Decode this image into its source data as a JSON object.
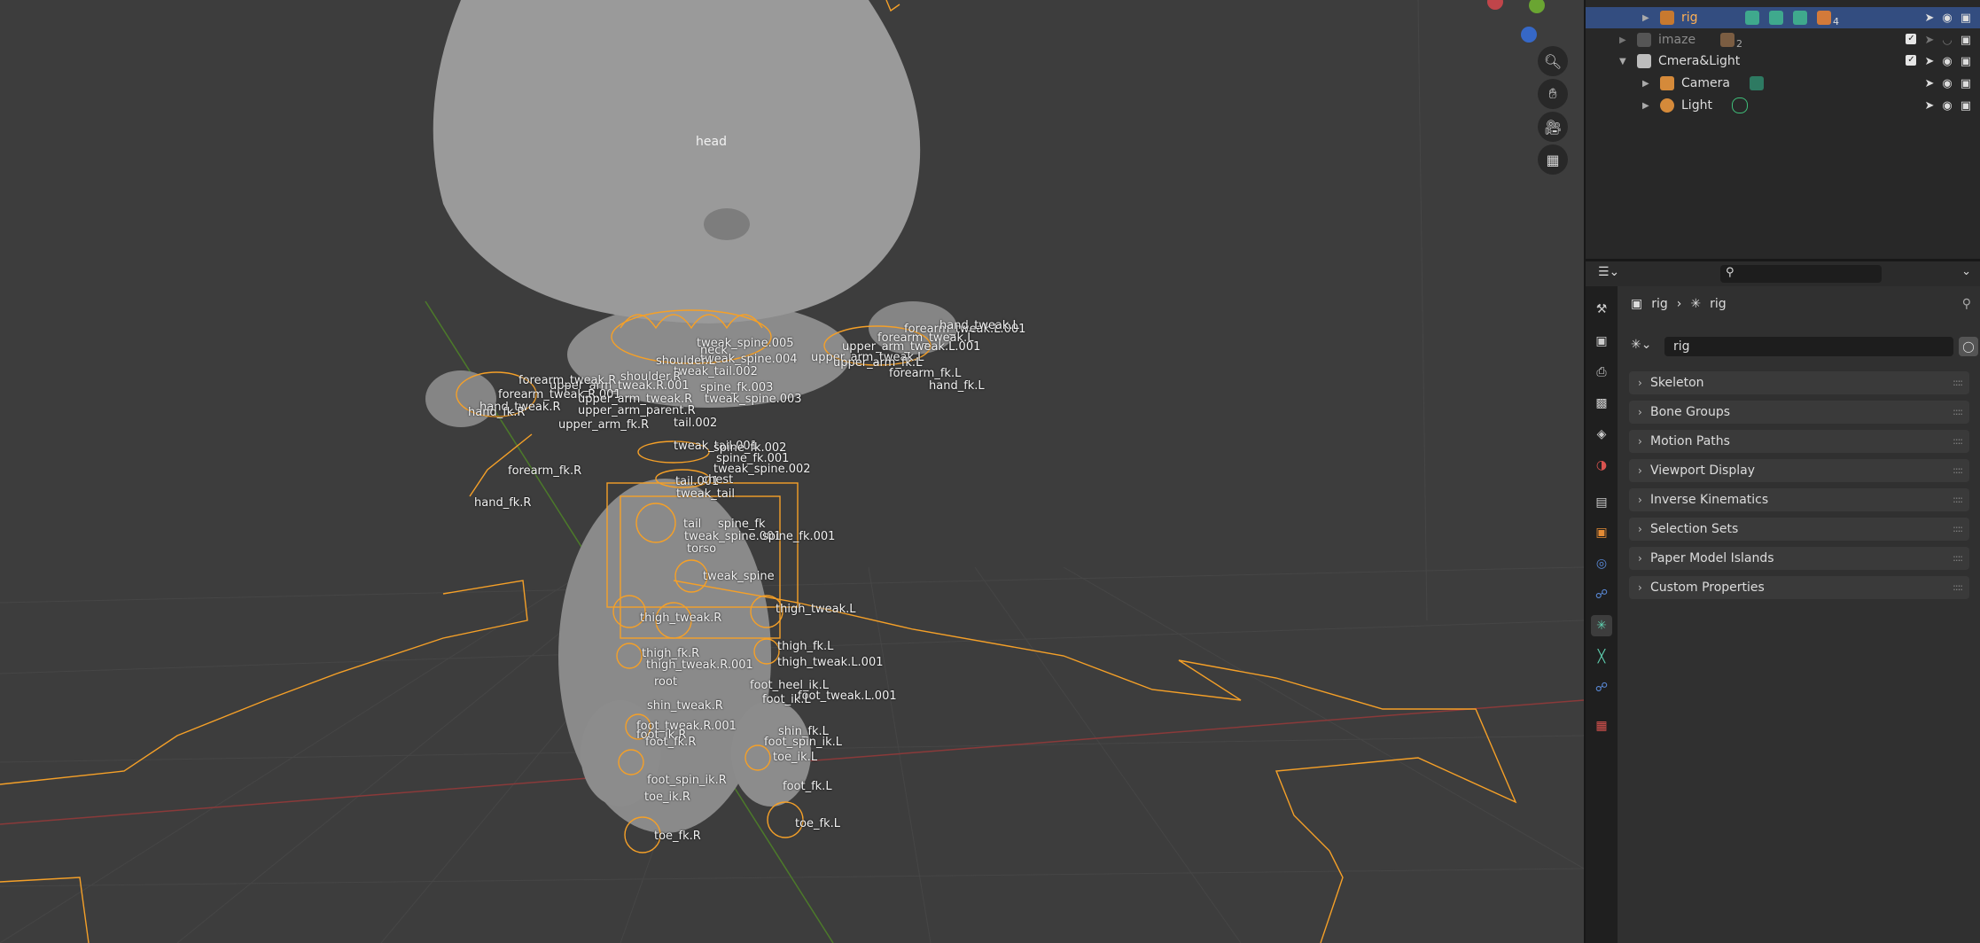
{
  "viewport": {
    "head_label": "head",
    "bone_labels": [
      [
        "forearm_tweak.L.001",
        1020,
        364
      ],
      [
        "hand_tweak.L",
        1060,
        360
      ],
      [
        "forearm_tweak.L",
        990,
        374
      ],
      [
        "upper_arm_tweak.L.001",
        950,
        384
      ],
      [
        "upper_arm_tweak.L",
        915,
        396
      ],
      [
        "upper_arm_fk.L",
        940,
        402
      ],
      [
        "forearm_fk.L",
        1003,
        414
      ],
      [
        "hand_fk.L",
        1048,
        428
      ],
      [
        "tweak_spine.005",
        786,
        380
      ],
      [
        "neck",
        790,
        388
      ],
      [
        "tweak_spine.004",
        790,
        398
      ],
      [
        "shoulder.L",
        740,
        400
      ],
      [
        "tweak_tail.002",
        760,
        412
      ],
      [
        "spine_fk.003",
        790,
        430
      ],
      [
        "tweak_spine.003",
        795,
        443
      ],
      [
        "tail.002",
        760,
        470
      ],
      [
        "shoulder.R",
        700,
        418
      ],
      [
        "upper_arm_tweak.R.001",
        620,
        428
      ],
      [
        "forearm_tweak.R",
        585,
        422
      ],
      [
        "forearm_tweak.R.001",
        562,
        438
      ],
      [
        "hand_tweak.R",
        541,
        452
      ],
      [
        "hand_fk.R",
        528,
        458
      ],
      [
        "upper_arm_tweak.R",
        652,
        443
      ],
      [
        "upper_arm_parent.R",
        652,
        456
      ],
      [
        "upper_arm_fk.R",
        630,
        472
      ],
      [
        "forearm_fk.R",
        573,
        524
      ],
      [
        "hand_fk.R",
        535,
        560
      ],
      [
        "tweak_tail.001",
        760,
        496
      ],
      [
        "spine_fk.002",
        805,
        498
      ],
      [
        "spine_fk.001",
        808,
        510
      ],
      [
        "tweak_spine.002",
        805,
        522
      ],
      [
        "tail.001",
        762,
        536
      ],
      [
        "chest",
        792,
        534
      ],
      [
        "tweak_tail",
        763,
        550
      ],
      [
        "tail",
        771,
        584
      ],
      [
        "spine_fk",
        810,
        584
      ],
      [
        "tweak_spine.001",
        772,
        598
      ],
      [
        "spine_fk.001",
        860,
        598
      ],
      [
        "torso",
        775,
        612
      ],
      [
        "tweak_spine",
        793,
        643
      ],
      [
        "thigh_tweak.R",
        722,
        690
      ],
      [
        "thigh_tweak.L",
        875,
        680
      ],
      [
        "thigh_fk.R",
        724,
        730
      ],
      [
        "thigh_fk.L",
        877,
        722
      ],
      [
        "thigh_tweak.R.001",
        729,
        743
      ],
      [
        "thigh_tweak.L.001",
        877,
        740
      ],
      [
        "root",
        738,
        762
      ],
      [
        "foot_heel_ik.L",
        846,
        766
      ],
      [
        "foot_tweak.L.001",
        900,
        778
      ],
      [
        "foot_ik.L",
        860,
        782
      ],
      [
        "shin_tweak.R",
        730,
        789
      ],
      [
        "foot_tweak.R.001",
        718,
        812
      ],
      [
        "foot_ik.R",
        718,
        822
      ],
      [
        "foot_fk.R",
        728,
        830
      ],
      [
        "shin_fk.L",
        878,
        818
      ],
      [
        "foot_spin_ik.L",
        862,
        830
      ],
      [
        "toe_ik.L",
        872,
        847
      ],
      [
        "foot_spin_ik.R",
        730,
        873
      ],
      [
        "foot_fk.L",
        883,
        880
      ],
      [
        "toe_ik.R",
        727,
        892
      ],
      [
        "toe_fk.L",
        897,
        922
      ],
      [
        "toe_fk.R",
        738,
        936
      ]
    ]
  },
  "nav_buttons": [
    "zoom-icon",
    "hand-pan-icon",
    "camera-view-icon",
    "grid-ortho-icon"
  ],
  "outliner": {
    "rows": [
      {
        "name": "rig",
        "selected": true,
        "indent": 2,
        "badge": "4"
      },
      {
        "name": "imaze",
        "selected": false,
        "indent": 1,
        "badge": "2"
      },
      {
        "name": "Cmera&Light",
        "selected": false,
        "indent": 1,
        "badge": ""
      },
      {
        "name": "Camera",
        "selected": false,
        "indent": 2,
        "badge": ""
      },
      {
        "name": "Light",
        "selected": false,
        "indent": 2,
        "badge": ""
      }
    ]
  },
  "properties": {
    "breadcrumb_object": "rig",
    "breadcrumb_data": "rig",
    "name_value": "rig",
    "panels": [
      "Skeleton",
      "Bone Groups",
      "Motion Paths",
      "Viewport Display",
      "Inverse Kinematics",
      "Selection Sets",
      "Paper Model Islands",
      "Custom Properties"
    ]
  },
  "colors": {
    "accent": "#334d80",
    "bone": "#f5a028",
    "active_tab": "#5fd0b0"
  }
}
